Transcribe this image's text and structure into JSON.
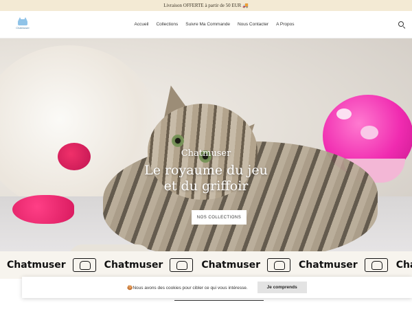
{
  "announcement": {
    "text": "Livraison OFFERTE à partir de 50 EUR 🚚"
  },
  "header": {
    "logo_text": "Chatmuser",
    "nav": [
      "Accueil",
      "Collections",
      "Suivre Ma Commande",
      "Nous Contacter",
      "A Propos"
    ],
    "search_icon": "search-icon"
  },
  "hero": {
    "subtitle": "Chatmuser",
    "title_line1": "Le royaume du jeu",
    "title_line2": "et du griffoir",
    "button_label": "NOS COLLECTIONS"
  },
  "marquee": {
    "items": [
      "Chatmuser",
      "Chatmuser",
      "Chatmuser",
      "Chatmuser",
      "Chatmuser"
    ],
    "icon": "cat-box-icon"
  },
  "cookie": {
    "text": "🍪Nous avons des cookies pour cibler ce qui vous intéresse.",
    "button_label": "Je comprends"
  },
  "colors": {
    "announcement_bg": "#f3ead4",
    "marquee_bg": "#f7f4ee",
    "cookie_button_bg": "#e3e3e3"
  }
}
